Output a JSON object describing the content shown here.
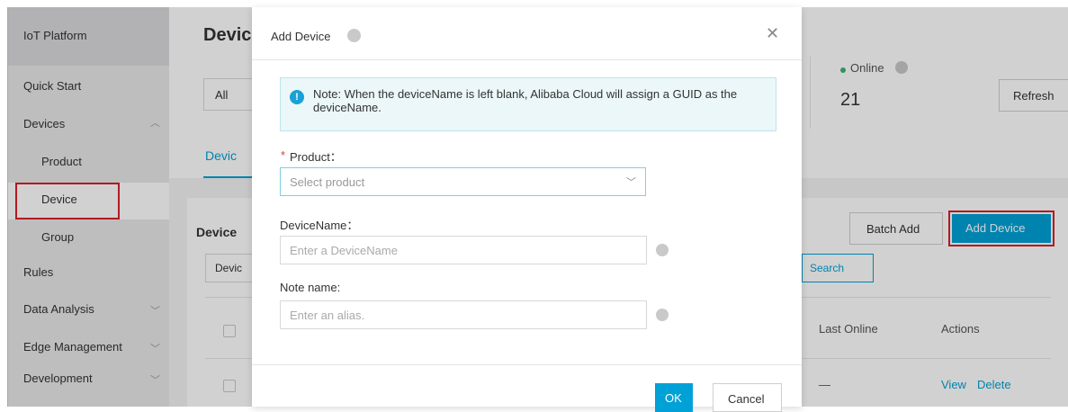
{
  "sidebar": {
    "title": "IoT Platform",
    "items": [
      {
        "label": "Quick Start"
      },
      {
        "label": "Devices",
        "chevron": "up"
      },
      {
        "label": "Product"
      },
      {
        "label": "Device",
        "active": true
      },
      {
        "label": "Group"
      },
      {
        "label": "Rules"
      },
      {
        "label": "Data Analysis",
        "chevron": "down"
      },
      {
        "label": "Edge Management",
        "chevron": "down"
      },
      {
        "label": "Development",
        "chevron": "down"
      }
    ]
  },
  "background": {
    "title": "Devic",
    "filter_value": "All",
    "tab": "Devic",
    "online_label": "Online",
    "online_count": "21",
    "refresh_label": "Refresh",
    "panel_title": "Device",
    "panel_filter": "Devic",
    "search_label": "Search",
    "batch_add_label": "Batch Add",
    "add_device_label": "Add Device",
    "col_last_online": "Last Online",
    "col_actions": "Actions",
    "row_last_online": "—",
    "view_label": "View",
    "delete_label": "Delete"
  },
  "modal": {
    "title": "Add Device",
    "notice": "Note: When the deviceName is left blank, Alibaba Cloud will assign a GUID as the deviceName.",
    "product_label": "Product：",
    "product_placeholder": "Select product",
    "devicename_label": "DeviceName：",
    "devicename_placeholder": "Enter a DeviceName",
    "notename_label": "Note name:",
    "notename_placeholder": "Enter an alias.",
    "ok_label": "OK",
    "cancel_label": "Cancel"
  },
  "colors": {
    "accent": "#00a1d6",
    "highlight_border": "#d9202a",
    "online": "#3cb371"
  }
}
